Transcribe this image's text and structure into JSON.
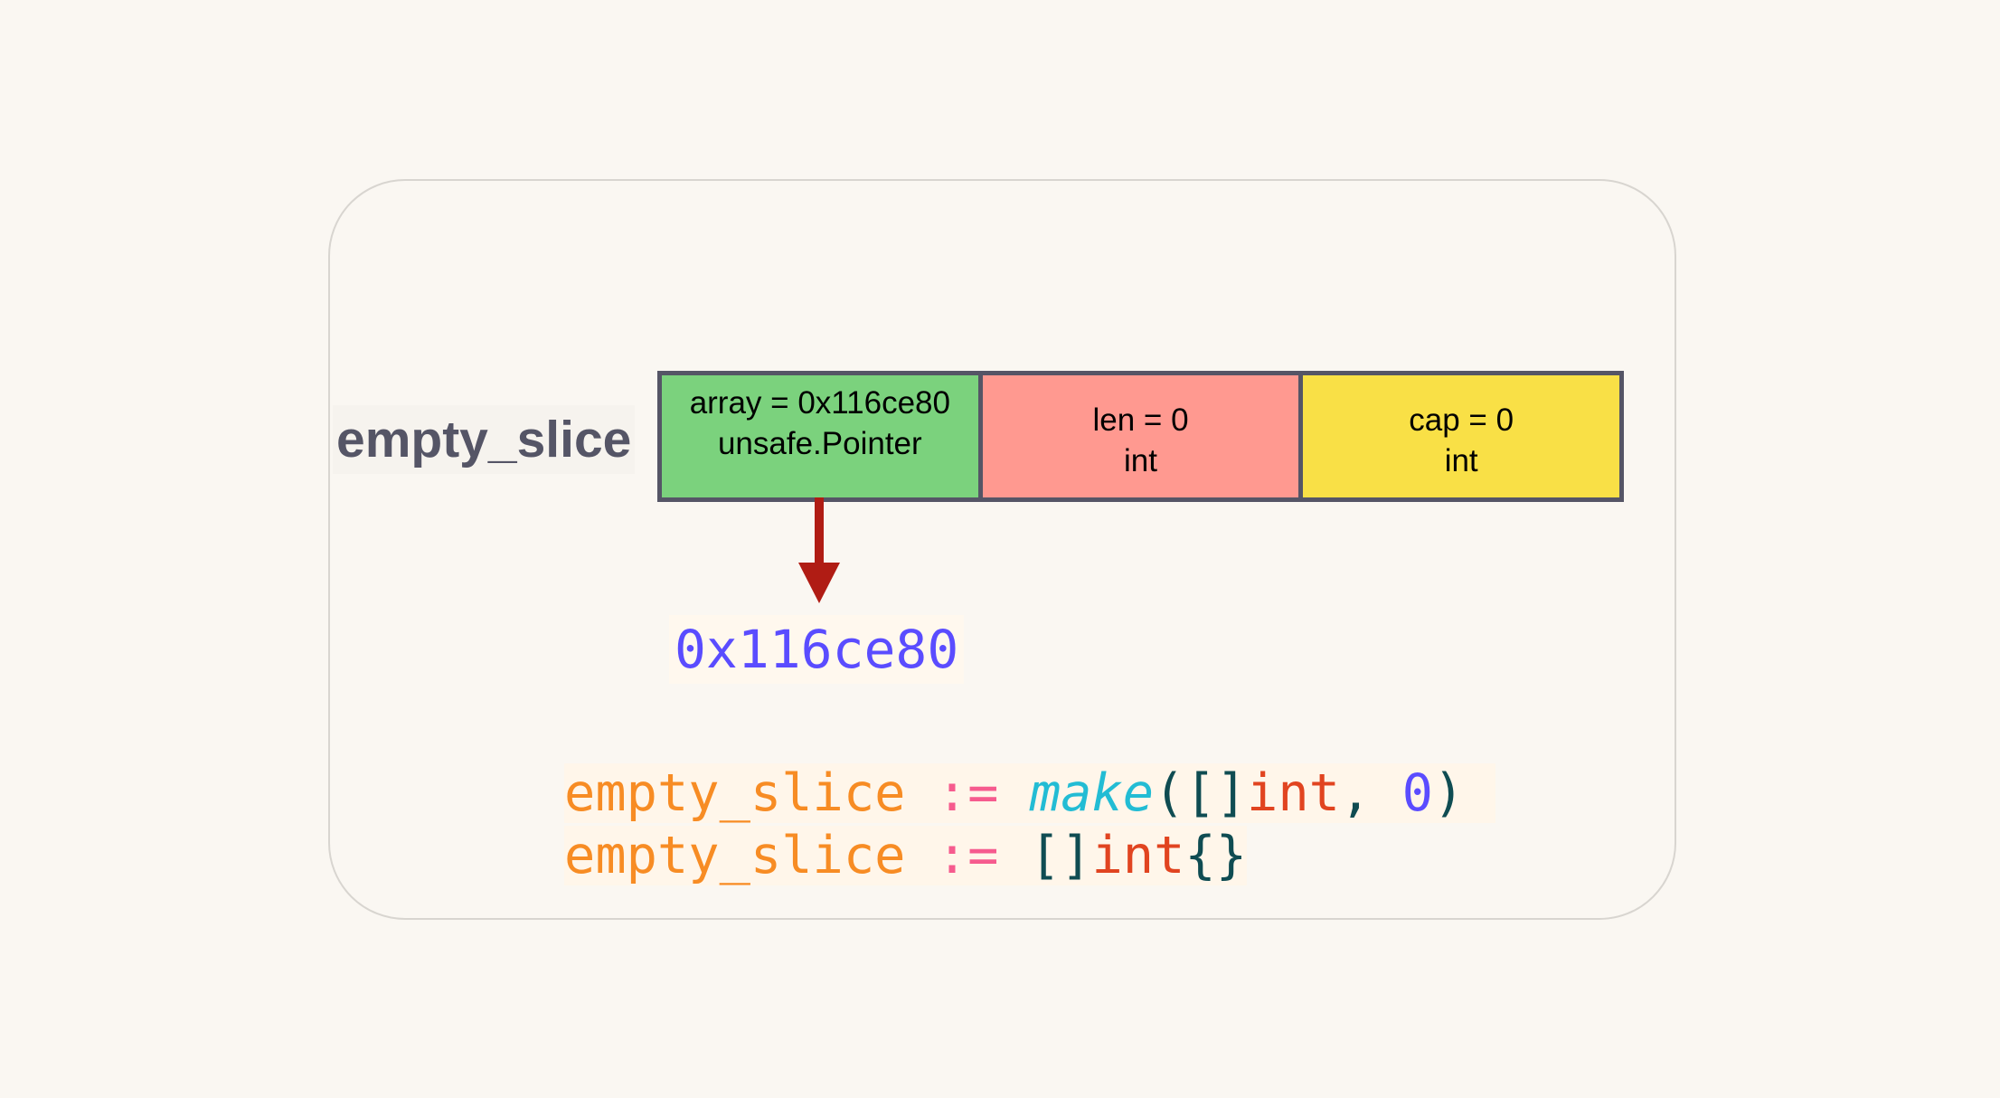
{
  "variable_label": "empty_slice",
  "struct_fields": [
    {
      "line1": "array = 0x116ce80",
      "line2": "unsafe.Pointer",
      "color": "#7bd27d"
    },
    {
      "line1": "len = 0",
      "line2": "int",
      "color": "#ff9990"
    },
    {
      "line1": "cap = 0",
      "line2": "int",
      "color": "#f9e046"
    }
  ],
  "pointer_target": "0x116ce80",
  "arrow_color": "#b01c14",
  "code": {
    "line1": {
      "var": "empty_slice",
      "op": ":=",
      "fn": "make",
      "open": "([]",
      "type": "int",
      "comma": ", ",
      "num": "0",
      "close": ")"
    },
    "line2": {
      "var": "empty_slice",
      "op": ":=",
      "open": "[]",
      "type": "int",
      "close": "{}"
    }
  }
}
